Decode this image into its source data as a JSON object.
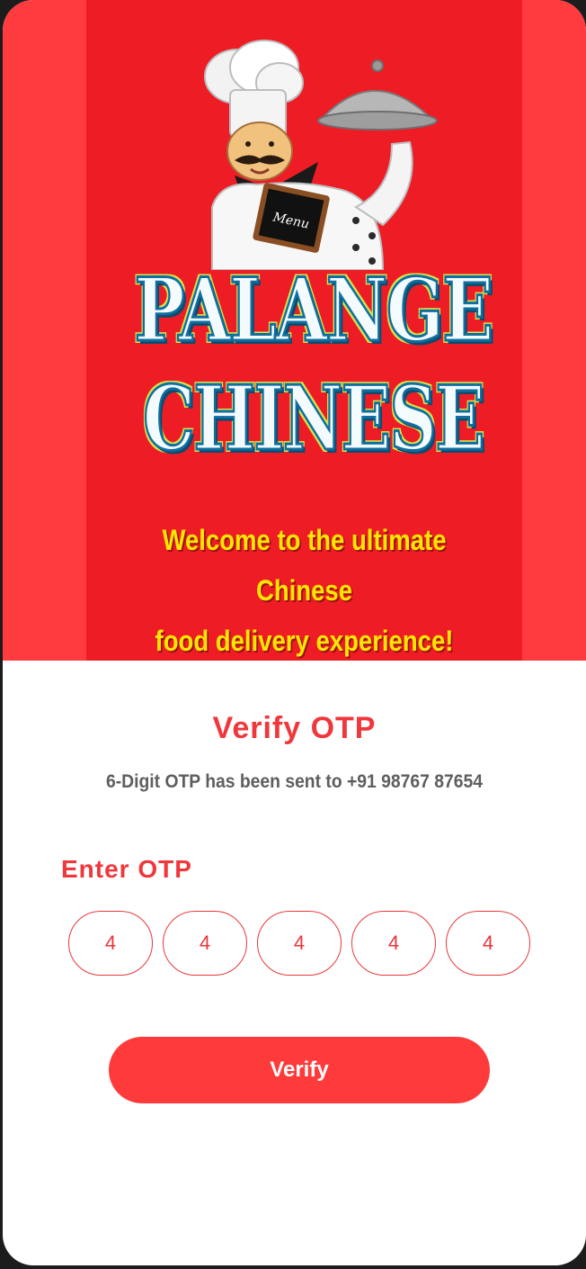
{
  "hero": {
    "brand_line1": "PALANGE",
    "brand_line2": "CHINESE",
    "menu_board_text": "Menu",
    "tagline_line1": "Welcome to the ultimate Chinese",
    "tagline_line2": "food delivery experience!"
  },
  "verify": {
    "title": "Verify OTP",
    "subtitle": "6-Digit OTP has been sent to +91 98767 87654",
    "otp_label": "Enter OTP",
    "otp_digits": [
      "4",
      "4",
      "4",
      "4",
      "4"
    ],
    "button_label": "Verify"
  },
  "colors": {
    "hero_bg": "#ff3b3f",
    "hero_panel": "#ee1c25",
    "accent": "#f0373c",
    "tagline": "#ffe600",
    "subtitle": "#5e5e5e"
  },
  "icons": {
    "chef": "chef-mascot-illustration"
  }
}
